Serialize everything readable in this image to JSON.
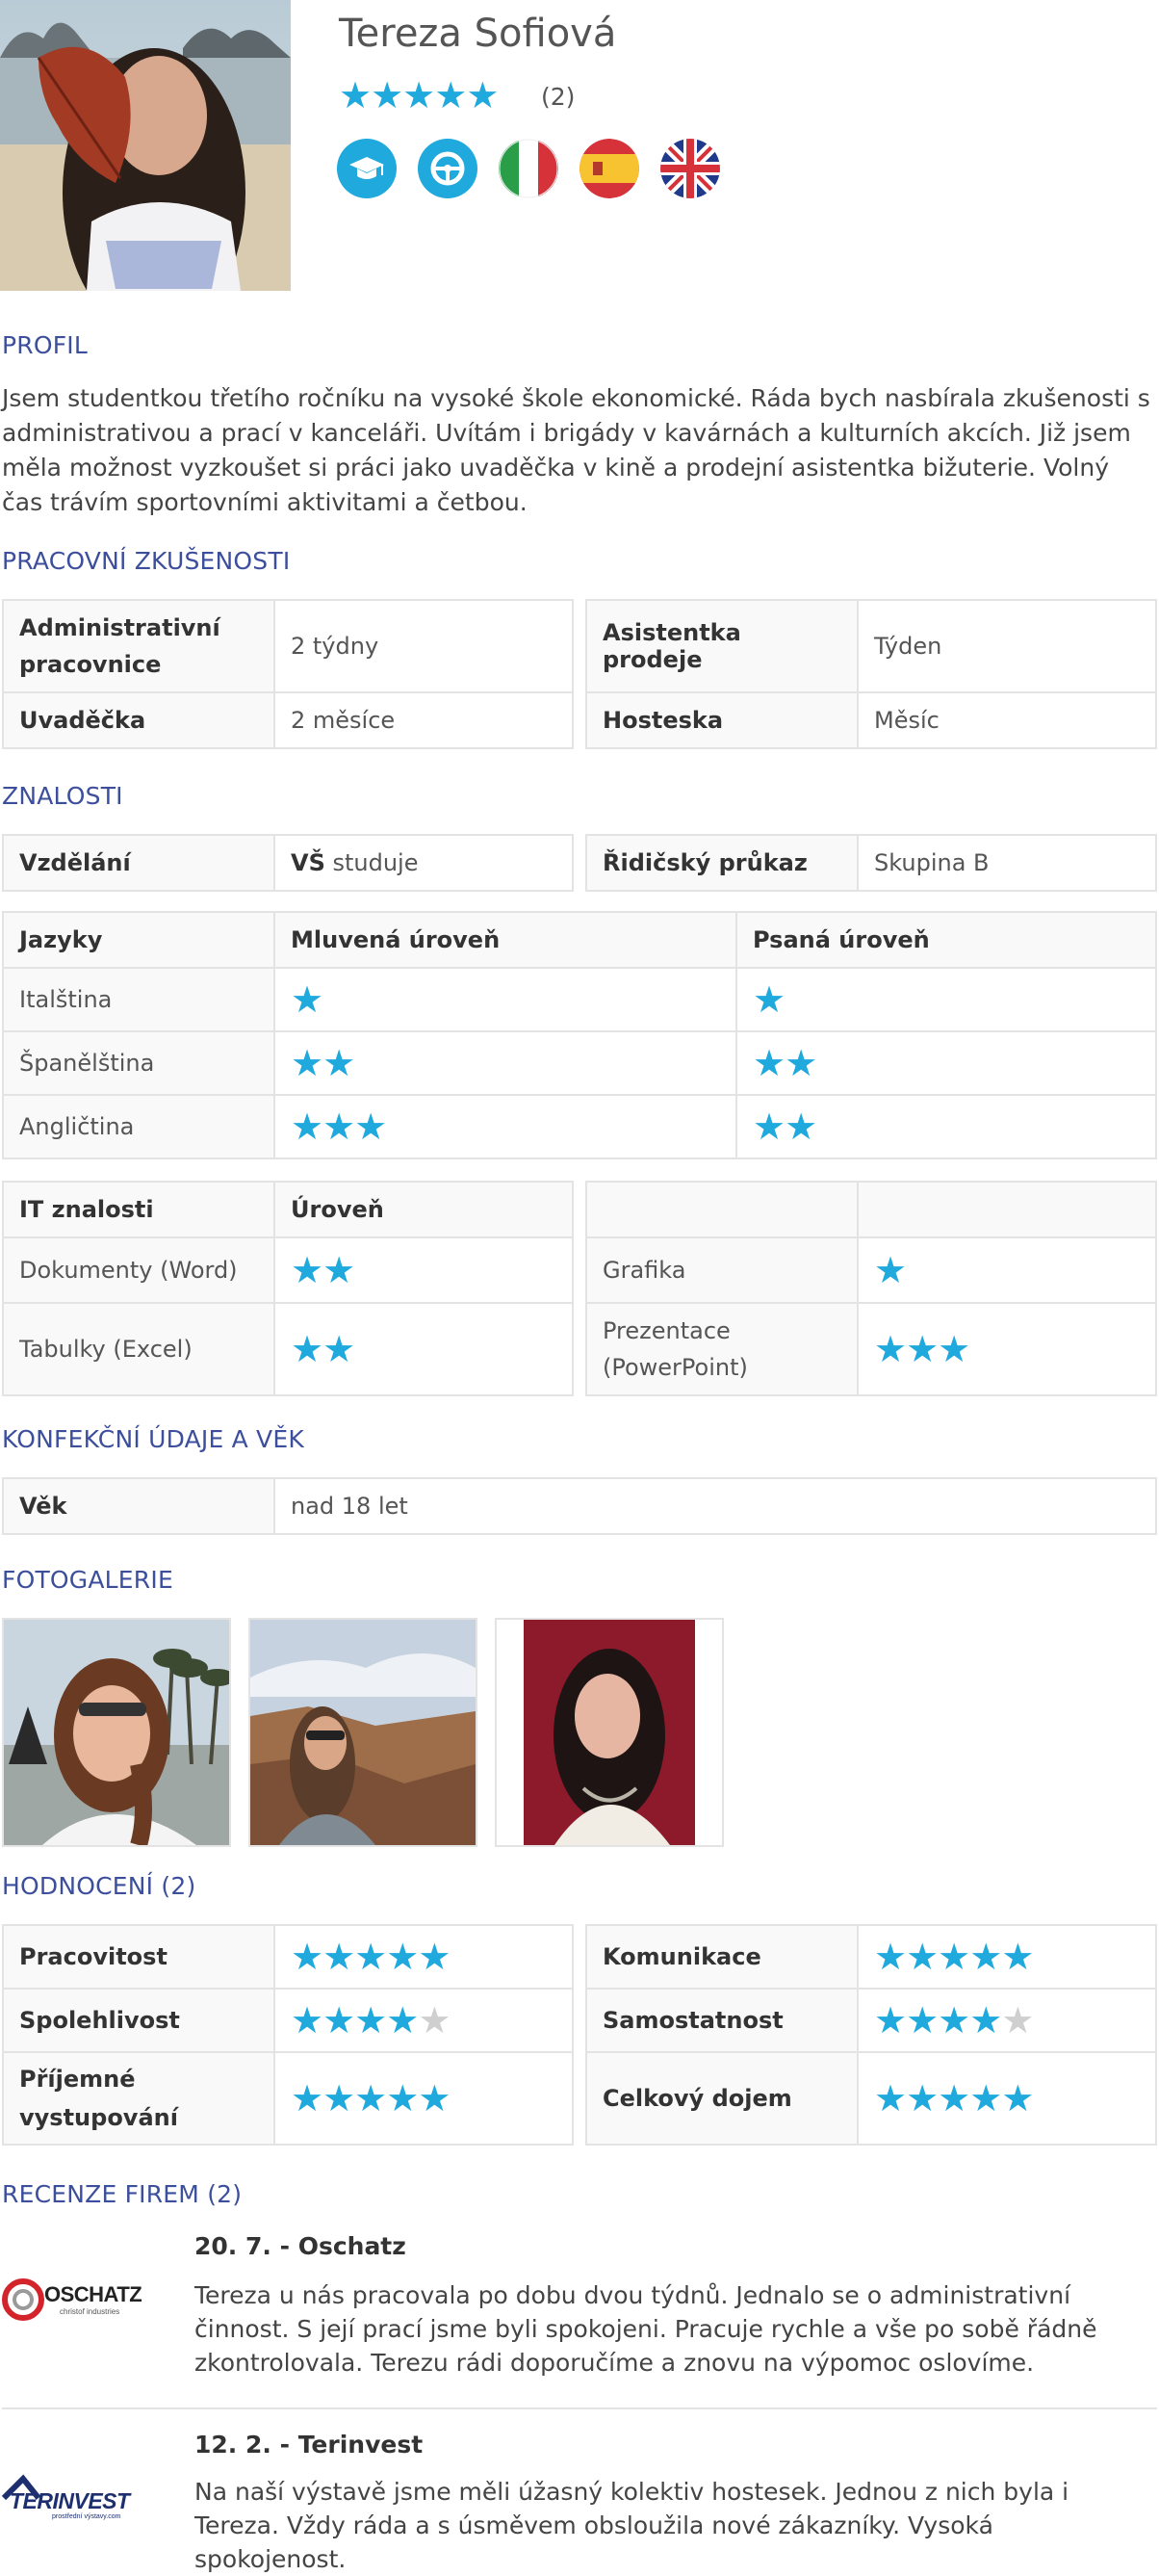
{
  "profile": {
    "name": "Tereza Sofiová",
    "rating_count": "(2)",
    "rating_stars": 5,
    "badges": [
      "graduation-cap-icon",
      "steering-wheel-icon",
      "flag-italy-icon",
      "flag-spain-icon",
      "flag-uk-icon"
    ]
  },
  "about": {
    "title": "PROFIL",
    "text": "Jsem studentkou třetího ročníku na vysoké škole ekonomické. Ráda bych nasbírala zkušenosti s administrativou a prací v kanceláři. Uvítám i brigády v kavárnách a kulturních akcích. Již jsem měla možnost vyzkoušet si práci jako uvaděčka v kině a prodejní asistentka bižuterie. Volný čas trávím sportovními aktivitami a četbou."
  },
  "experience": {
    "title": "PRACOVNÍ ZKUŠENOSTI",
    "rows": [
      [
        {
          "label": "Administrativní pracovnice",
          "value": "2 týdny"
        },
        {
          "label": "Asistentka prodeje",
          "value": "Týden"
        }
      ],
      [
        {
          "label": "Uvaděčka",
          "value": "2 měsíce"
        },
        {
          "label": "Hosteska",
          "value": "Měsíc"
        }
      ]
    ]
  },
  "skills": {
    "title": "ZNALOSTI",
    "education_label": "Vzdělání",
    "education_bold": "VŠ",
    "education_rest": " studuje",
    "license_label": "Řidičský průkaz",
    "license_value": "Skupina B",
    "languages_header": [
      "Jazyky",
      "Mluvená úroveň",
      "Psaná úroveň"
    ],
    "languages": [
      {
        "name": "Italština",
        "spoken": 1,
        "written": 1
      },
      {
        "name": "Španělština",
        "spoken": 2,
        "written": 2
      },
      {
        "name": "Angličtina",
        "spoken": 3,
        "written": 2
      }
    ],
    "it_header": [
      "IT znalosti",
      "Úroveň"
    ],
    "it": [
      [
        {
          "name": "Dokumenty (Word)",
          "level": 2
        },
        {
          "name": "Grafika",
          "level": 1
        }
      ],
      [
        {
          "name": "Tabulky (Excel)",
          "level": 2
        },
        {
          "name": "Prezentace (PowerPoint)",
          "level": 3
        }
      ]
    ]
  },
  "measures": {
    "title": "KONFEKČNÍ ÚDAJE A VĚK",
    "age_label": "Věk",
    "age_value": "nad 18 let"
  },
  "gallery": {
    "title": "FOTOGALERIE"
  },
  "ratings": {
    "title": "HODNOCENÍ (2)",
    "rows": [
      [
        {
          "label": "Pracovitost",
          "stars": 5
        },
        {
          "label": "Komunikace",
          "stars": 5
        }
      ],
      [
        {
          "label": "Spolehlivost",
          "stars": 4
        },
        {
          "label": "Samostatnost",
          "stars": 4
        }
      ],
      [
        {
          "label": "Příjemné vystupování",
          "stars": 5
        },
        {
          "label": "Celkový dojem",
          "stars": 5
        }
      ]
    ]
  },
  "reviews": {
    "title": "RECENZE FIREM (2)",
    "items": [
      {
        "date": "20. 7.",
        "company": "Oschatz",
        "logo_text": "OSCHATZ",
        "logo_sub": "christof industries",
        "text": "Tereza u nás pracovala po dobu dvou týdnů. Jednalo se o administrativní činnost. S její prací jsme byli spokojeni. Pracuje rychle a vše po sobě řádně zkontrolovala. Terezu rádi doporučíme a znovu na výpomoc oslovíme."
      },
      {
        "date": "12. 2.",
        "company": "Terinvest",
        "logo_text": "TERINVEST",
        "logo_sub": "prostřední výstavy.com",
        "text": "Na naší výstavě jsme měli úžasný kolektiv hostesek. Jednou z nich byla i Tereza. Vždy ráda a s úsměvem obsloužila nové zákazníky. Vysoká spokojenost."
      }
    ]
  },
  "colors": {
    "accent": "#1fa9dd",
    "heading": "#3c4f9c",
    "star_off": "#cfcfcf"
  }
}
